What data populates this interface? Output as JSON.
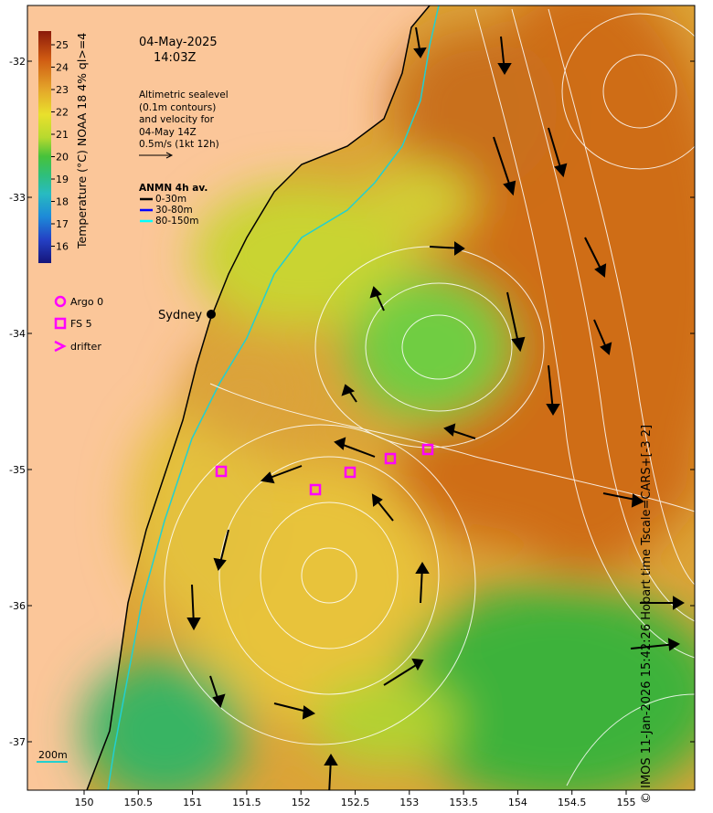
{
  "header": {
    "date": "04-May-2025",
    "time": "14:03Z"
  },
  "altimetry_note": [
    "Altimetric sealevel",
    "(0.1m contours)",
    "and velocity for",
    "04-May 14Z",
    "0.5m/s (1kt 12h)"
  ],
  "anmn": {
    "title": "ANMN 4h av.",
    "items": [
      {
        "label": "0-30m",
        "color": "#000000"
      },
      {
        "label": "30-80m",
        "color": "#0000ff"
      },
      {
        "label": "80-150m",
        "color": "#00ffff"
      }
    ]
  },
  "colorbar": {
    "label": "Temperature (°C) NOAA 18 4% ql>=4",
    "ticks": [
      "25",
      "24",
      "23",
      "22",
      "21",
      "20",
      "19",
      "18",
      "17",
      "16"
    ]
  },
  "markers_legend": [
    {
      "label": "Argo 0",
      "shape": "circle",
      "color": "#ff00ff"
    },
    {
      "label": "FS 5",
      "shape": "square",
      "color": "#ff00ff"
    },
    {
      "label": "drifter",
      "shape": "chevron",
      "color": "#ff00ff"
    }
  ],
  "city": {
    "name": "Sydney"
  },
  "scale": {
    "isobath": "200m"
  },
  "axes": {
    "x_ticks": [
      "150",
      "150.5",
      "151",
      "151.5",
      "152",
      "152.5",
      "153",
      "153.5",
      "154",
      "154.5",
      "155"
    ],
    "y_ticks": [
      "-32",
      "-33",
      "-34",
      "-35",
      "-36",
      "-37"
    ]
  },
  "stamp": "© IMOS 11-Jan-2026 15:42:26 Hobart time Tscale=CARS+[-3 2]",
  "colors": {
    "land": "#fbc699",
    "warm": "#cf6d18",
    "mid": "#e5b632",
    "cool": "#6fd046",
    "marker": "#ff00ff",
    "isobath": "#22d0d0"
  }
}
